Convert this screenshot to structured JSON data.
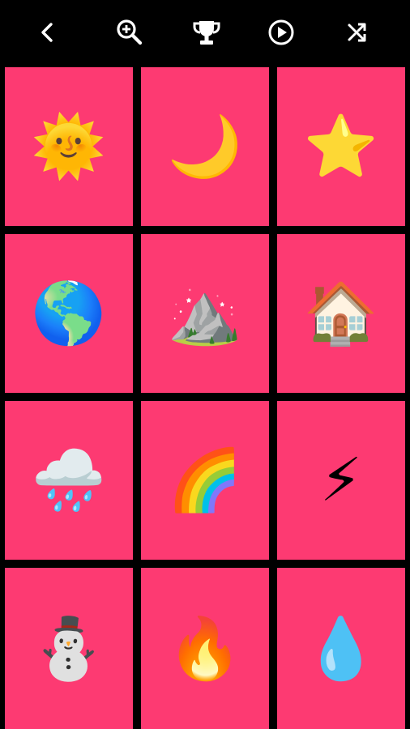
{
  "toolbar": {
    "buttons": [
      {
        "name": "back-button",
        "icon": "chevron-left-icon"
      },
      {
        "name": "zoom-button",
        "icon": "zoom-in-icon"
      },
      {
        "name": "leaderboard-button",
        "icon": "trophy-icon"
      },
      {
        "name": "play-button",
        "icon": "play-circle-icon"
      },
      {
        "name": "shuffle-button",
        "icon": "shuffle-icon"
      }
    ]
  },
  "colors": {
    "background": "#000000",
    "tile": "#fd3a72",
    "icon": "#ffffff"
  },
  "tiles": [
    {
      "name": "sun",
      "glyph": "🌞"
    },
    {
      "name": "moon",
      "glyph": "🌙"
    },
    {
      "name": "star",
      "glyph": "⭐"
    },
    {
      "name": "globe",
      "glyph": "🌎"
    },
    {
      "name": "mountain",
      "glyph": "⛰️"
    },
    {
      "name": "house",
      "glyph": "🏠"
    },
    {
      "name": "rain-cloud",
      "glyph": "🌧️"
    },
    {
      "name": "rainbow",
      "glyph": "🌈"
    },
    {
      "name": "lightning",
      "glyph": "⚡"
    },
    {
      "name": "snowman",
      "glyph": "⛄"
    },
    {
      "name": "fire",
      "glyph": "🔥"
    },
    {
      "name": "droplet",
      "glyph": "💧"
    }
  ]
}
